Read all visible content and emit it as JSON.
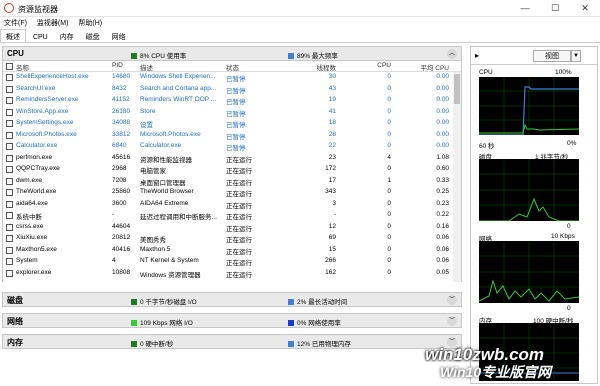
{
  "window": {
    "title": "资源监视器"
  },
  "menu": [
    "文件(F)",
    "监视器(M)",
    "帮助(H)"
  ],
  "tabs": [
    "概述",
    "CPU",
    "内存",
    "磁盘",
    "网络"
  ],
  "cpu_section": {
    "name": "CPU",
    "stat1": "8% CPU 使用率",
    "stat2": "89% 最大频率",
    "color1": "#1e7b1e",
    "color2": "#3f7fd8"
  },
  "columns": [
    "名称",
    "PID",
    "描述",
    "状态",
    "线程数",
    "CPU",
    "平均 CPU"
  ],
  "processes": [
    {
      "name": "ShellExperienceHost.exe",
      "pid": "14680",
      "desc": "Windows Shell Experien...",
      "status": "已暂停",
      "threads": "30",
      "cpu": "0",
      "avg": "0.00",
      "suspended": true
    },
    {
      "name": "SearchUI.exe",
      "pid": "8432",
      "desc": "Search and Cortana app...",
      "status": "已暂停",
      "threads": "43",
      "cpu": "0",
      "avg": "0.00",
      "suspended": true
    },
    {
      "name": "RemindersServer.exe",
      "pid": "41152",
      "desc": "Reminders WinRT OOP ...",
      "status": "已暂停",
      "threads": "19",
      "cpu": "0",
      "avg": "0.00",
      "suspended": true
    },
    {
      "name": "WinStore.App.exe",
      "pid": "26180",
      "desc": "Store",
      "status": "已暂停",
      "threads": "41",
      "cpu": "0",
      "avg": "0.00",
      "suspended": true
    },
    {
      "name": "SystemSettings.exe",
      "pid": "34088",
      "desc": "设置",
      "status": "已暂停",
      "threads": "18",
      "cpu": "0",
      "avg": "0.00",
      "suspended": true
    },
    {
      "name": "Microsoft.Photos.exe",
      "pid": "33812",
      "desc": "Microsoft.Photos.exe",
      "status": "已暂停",
      "threads": "28",
      "cpu": "0",
      "avg": "0.00",
      "suspended": true
    },
    {
      "name": "Calculator.exe",
      "pid": "6840",
      "desc": "Calculator.exe",
      "status": "已暂停",
      "threads": "22",
      "cpu": "0",
      "avg": "0.00",
      "suspended": true
    },
    {
      "name": "perfmon.exe",
      "pid": "45616",
      "desc": "资源和性能监视器",
      "status": "正在运行",
      "threads": "23",
      "cpu": "4",
      "avg": "1.08",
      "suspended": false
    },
    {
      "name": "QQPCTray.exe",
      "pid": "2968",
      "desc": "电脑管家",
      "status": "正在运行",
      "threads": "172",
      "cpu": "0",
      "avg": "0.60",
      "suspended": false
    },
    {
      "name": "dwm.exe",
      "pid": "7208",
      "desc": "桌面窗口管理器",
      "status": "正在运行",
      "threads": "17",
      "cpu": "1",
      "avg": "0.33",
      "suspended": false
    },
    {
      "name": "TheWorld.exe",
      "pid": "25860",
      "desc": "TheWorld Browser",
      "status": "正在运行",
      "threads": "343",
      "cpu": "0",
      "avg": "0.25",
      "suspended": false
    },
    {
      "name": "aida64.exe",
      "pid": "3600",
      "desc": "AIDA64 Extreme",
      "status": "正在运行",
      "threads": "3",
      "cpu": "0",
      "avg": "0.23",
      "suspended": false
    },
    {
      "name": "系统中断",
      "pid": "-",
      "desc": "延迟过程调用和中断服务...",
      "status": "正在运行",
      "threads": "-",
      "cpu": "0",
      "avg": "0.22",
      "suspended": false
    },
    {
      "name": "csrss.exe",
      "pid": "44604",
      "desc": "",
      "status": "正在运行",
      "threads": "12",
      "cpu": "0",
      "avg": "0.16",
      "suspended": false
    },
    {
      "name": "XiuXiu.exe",
      "pid": "20812",
      "desc": "美图秀秀",
      "status": "正在运行",
      "threads": "69",
      "cpu": "0",
      "avg": "0.06",
      "suspended": false
    },
    {
      "name": "Maxthon5.exe",
      "pid": "40416",
      "desc": "Maxthon 5",
      "status": "正在运行",
      "threads": "15",
      "cpu": "0",
      "avg": "0.06",
      "suspended": false
    },
    {
      "name": "System",
      "pid": "4",
      "desc": "NT Kernel & System",
      "status": "正在运行",
      "threads": "266",
      "cpu": "0",
      "avg": "0.06",
      "suspended": false
    },
    {
      "name": "explorer.exe",
      "pid": "10808",
      "desc": "Windows 资源管理器",
      "status": "正在运行",
      "threads": "162",
      "cpu": "0",
      "avg": "0.05",
      "suspended": false
    }
  ],
  "disk_section": {
    "name": "磁盘",
    "stat1": "0 千字节/秒磁盘 I/O",
    "stat2": "2% 最长活动时间",
    "color1": "#1e7b1e",
    "color2": "#3f7fd8"
  },
  "network_section": {
    "name": "网络",
    "stat1": "109 Kbps 网络 I/O",
    "stat2": "0% 网络使用率",
    "color1": "#33cc33",
    "color2": "#1a3bd1"
  },
  "memory_section": {
    "name": "内存",
    "stat1": "0 硬中断/秒",
    "stat2": "12% 已用物理内存",
    "color1": "#1e7b1e",
    "color2": "#3f7fd8"
  },
  "right": {
    "view_label": "视图",
    "cpu_label": "CPU",
    "cpu_max": "100%",
    "cpu_time": "60 秒",
    "cpu_min": "0%",
    "disk_label": "磁盘",
    "disk_max": "1 兆字节/秒",
    "disk_min": "0",
    "net_label": "网络",
    "net_max": "10 Kbps",
    "net_min": "0",
    "mem_label": "内存",
    "mem_max": "100 硬中断/秒"
  },
  "watermark": {
    "line1": "win10zwb.com",
    "line2": "Win10专业版官网"
  }
}
